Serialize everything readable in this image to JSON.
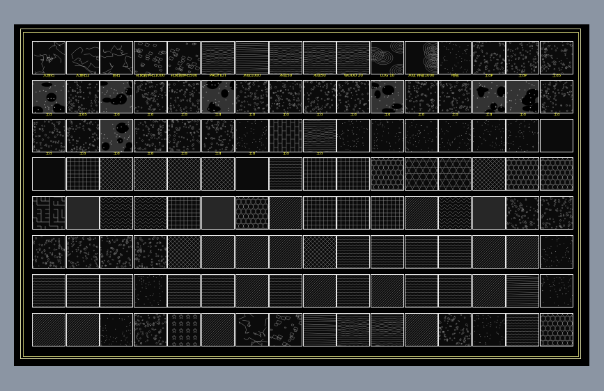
{
  "colors": {
    "viewport_background": "#8b95a3",
    "sheet_background": "#000000",
    "frame": "#d9d9a0",
    "swatch_border": "#e8e8e8",
    "label_text": "#ffff33",
    "hatch_line": "#9a9a9a"
  },
  "palette": {
    "rows": [
      [
        {
          "label": "大理石",
          "pattern": "marble"
        },
        {
          "label": "大理石2",
          "pattern": "marble"
        },
        {
          "label": "岩石",
          "pattern": "marble"
        },
        {
          "label": "花岗岩碎石1000",
          "pattern": "stone"
        },
        {
          "label": "花岗岩碎石500",
          "pattern": "stone"
        },
        {
          "label": "PROFILIT",
          "pattern": "wood"
        },
        {
          "label": "木纹1000",
          "pattern": "hlines"
        },
        {
          "label": "木纹50",
          "pattern": "wood"
        },
        {
          "label": "木纹50",
          "pattern": "wood"
        },
        {
          "label": "WOOD 20",
          "pattern": "wood"
        },
        {
          "label": "LOG 10",
          "pattern": "rings"
        },
        {
          "label": "木纹 排版1000",
          "pattern": "rings"
        },
        {
          "label": "地毯",
          "pattern": "dots"
        },
        {
          "label": "土dP",
          "pattern": "dense"
        },
        {
          "label": "土dP",
          "pattern": "dense"
        },
        {
          "label": "土d5",
          "pattern": "dense"
        }
      ],
      [
        {
          "label": "土d",
          "pattern": "blotch"
        },
        {
          "label": "土d5",
          "pattern": "dense"
        },
        {
          "label": "土d",
          "pattern": "blotch"
        },
        {
          "label": "土d",
          "pattern": "dense"
        },
        {
          "label": "土d",
          "pattern": "dense"
        },
        {
          "label": "土d",
          "pattern": "blotch"
        },
        {
          "label": "土d",
          "pattern": "dense"
        },
        {
          "label": "土d",
          "pattern": "dense"
        },
        {
          "label": "土d",
          "pattern": "dense"
        },
        {
          "label": "土d",
          "pattern": "dense"
        },
        {
          "label": "土d",
          "pattern": "blotch"
        },
        {
          "label": "土d",
          "pattern": "dense"
        },
        {
          "label": "土d",
          "pattern": "dense"
        },
        {
          "label": "土d",
          "pattern": "blotch"
        },
        {
          "label": "土d",
          "pattern": "blotch"
        },
        {
          "label": "土d",
          "pattern": "dense"
        }
      ],
      [
        {
          "label": "土d",
          "pattern": "dense"
        },
        {
          "label": "土d",
          "pattern": "dense"
        },
        {
          "label": "土d",
          "pattern": "blotch"
        },
        {
          "label": "土d",
          "pattern": "dense"
        },
        {
          "label": "土d",
          "pattern": "dense"
        },
        {
          "label": "土d",
          "pattern": "dense"
        },
        {
          "label": "土d",
          "pattern": "dots"
        },
        {
          "label": "土d",
          "pattern": "planks"
        },
        {
          "label": "土d",
          "pattern": "wood"
        },
        {
          "label": "",
          "pattern": "dots"
        },
        {
          "label": "",
          "pattern": "dots"
        },
        {
          "label": "",
          "pattern": "dots"
        },
        {
          "label": "",
          "pattern": "dots"
        },
        {
          "label": "",
          "pattern": "dots"
        },
        {
          "label": "",
          "pattern": "dots"
        },
        {
          "label": "",
          "pattern": "solid"
        }
      ],
      [
        {
          "label": "",
          "pattern": "solid"
        },
        {
          "label": "",
          "pattern": "grid"
        },
        {
          "label": "",
          "pattern": "diamond"
        },
        {
          "label": "",
          "pattern": "diamond"
        },
        {
          "label": "",
          "pattern": "diamond"
        },
        {
          "label": "",
          "pattern": "diamond"
        },
        {
          "label": "",
          "pattern": "solid"
        },
        {
          "label": "",
          "pattern": "waves"
        },
        {
          "label": "",
          "pattern": "grid"
        },
        {
          "label": "",
          "pattern": "grid"
        },
        {
          "label": "",
          "pattern": "circles"
        },
        {
          "label": "",
          "pattern": "hex"
        },
        {
          "label": "",
          "pattern": "hex"
        },
        {
          "label": "",
          "pattern": "diamond"
        },
        {
          "label": "",
          "pattern": "circles"
        },
        {
          "label": "",
          "pattern": "circles"
        }
      ],
      [
        {
          "label": "",
          "pattern": "maze"
        },
        {
          "label": "",
          "pattern": "weave"
        },
        {
          "label": "",
          "pattern": "herring"
        },
        {
          "label": "",
          "pattern": "herring"
        },
        {
          "label": "",
          "pattern": "grid"
        },
        {
          "label": "",
          "pattern": "weave"
        },
        {
          "label": "",
          "pattern": "circles"
        },
        {
          "label": "",
          "pattern": "diagonal"
        },
        {
          "label": "",
          "pattern": "grid"
        },
        {
          "label": "",
          "pattern": "grid"
        },
        {
          "label": "",
          "pattern": "grid"
        },
        {
          "label": "",
          "pattern": "diagonal"
        },
        {
          "label": "",
          "pattern": "herring"
        },
        {
          "label": "",
          "pattern": "weave"
        },
        {
          "label": "",
          "pattern": "dense"
        },
        {
          "label": "",
          "pattern": "dense"
        }
      ],
      [
        {
          "label": "",
          "pattern": "dense"
        },
        {
          "label": "",
          "pattern": "dense"
        },
        {
          "label": "",
          "pattern": "dense"
        },
        {
          "label": "",
          "pattern": "dense"
        },
        {
          "label": "",
          "pattern": "diamond"
        },
        {
          "label": "",
          "pattern": "diagonal"
        },
        {
          "label": "",
          "pattern": "diagonal"
        },
        {
          "label": "",
          "pattern": "diagonal"
        },
        {
          "label": "",
          "pattern": "diamond"
        },
        {
          "label": "",
          "pattern": "waves"
        },
        {
          "label": "",
          "pattern": "waves"
        },
        {
          "label": "",
          "pattern": "waves"
        },
        {
          "label": "",
          "pattern": "waves"
        },
        {
          "label": "",
          "pattern": "diagonal"
        },
        {
          "label": "",
          "pattern": "diagonal"
        },
        {
          "label": "",
          "pattern": "dots"
        }
      ],
      [
        {
          "label": "",
          "pattern": "waves"
        },
        {
          "label": "",
          "pattern": "waves"
        },
        {
          "label": "",
          "pattern": "waves"
        },
        {
          "label": "",
          "pattern": "dots"
        },
        {
          "label": "",
          "pattern": "waves"
        },
        {
          "label": "",
          "pattern": "waves"
        },
        {
          "label": "",
          "pattern": "diagonal"
        },
        {
          "label": "",
          "pattern": "waves"
        },
        {
          "label": "",
          "pattern": "diagonal"
        },
        {
          "label": "",
          "pattern": "waves"
        },
        {
          "label": "",
          "pattern": "diagonal"
        },
        {
          "label": "",
          "pattern": "waves"
        },
        {
          "label": "",
          "pattern": "waves"
        },
        {
          "label": "",
          "pattern": "diagonal"
        },
        {
          "label": "",
          "pattern": "hlines"
        },
        {
          "label": "",
          "pattern": "dots"
        }
      ],
      [
        {
          "label": "",
          "pattern": "diagonal"
        },
        {
          "label": "",
          "pattern": "diagonal"
        },
        {
          "label": "",
          "pattern": "dots"
        },
        {
          "label": "",
          "pattern": "dense"
        },
        {
          "label": "",
          "pattern": "stars"
        },
        {
          "label": "",
          "pattern": "diagonal"
        },
        {
          "label": "",
          "pattern": "marble"
        },
        {
          "label": "",
          "pattern": "stone"
        },
        {
          "label": "",
          "pattern": "hlines"
        },
        {
          "label": "",
          "pattern": "wood"
        },
        {
          "label": "",
          "pattern": "wood"
        },
        {
          "label": "",
          "pattern": "diagonal"
        },
        {
          "label": "",
          "pattern": "dense"
        },
        {
          "label": "",
          "pattern": "dots"
        },
        {
          "label": "",
          "pattern": "waves"
        },
        {
          "label": "",
          "pattern": "circles"
        }
      ]
    ]
  }
}
